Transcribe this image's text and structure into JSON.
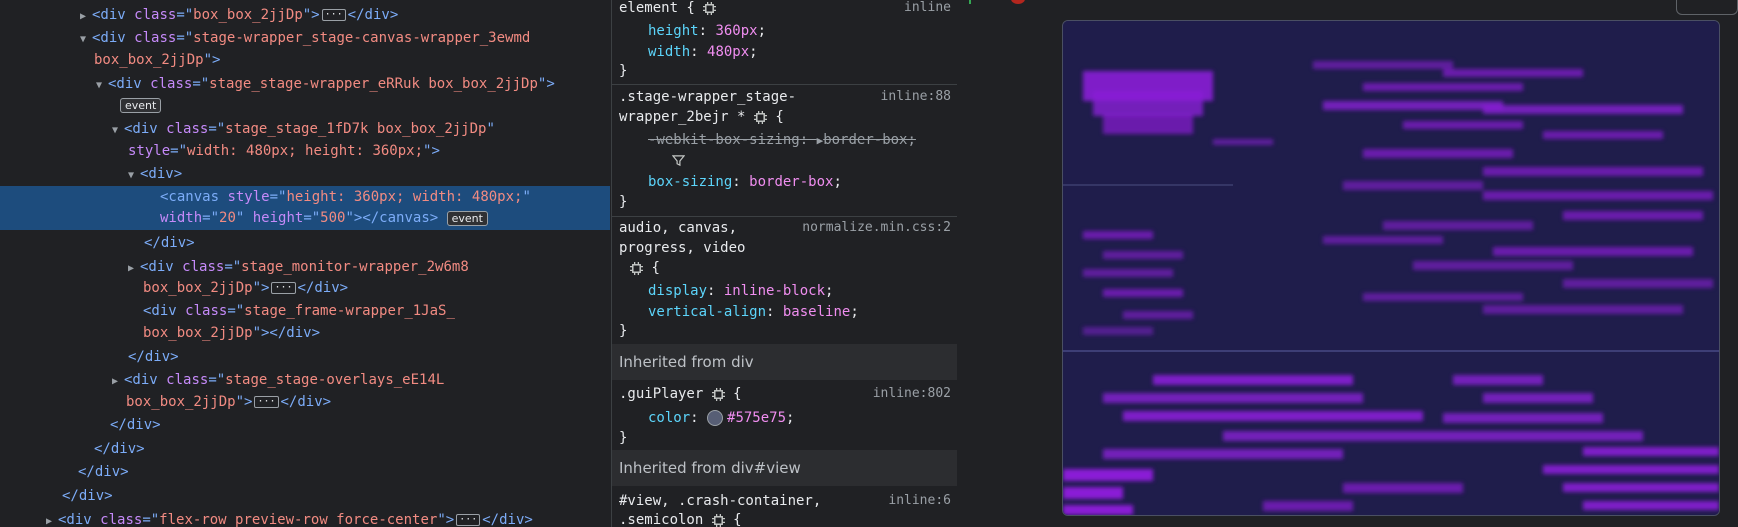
{
  "dom": {
    "line1_cls": "box_box_2jjDp",
    "line2_cls_a": "stage-wrapper_stage-canvas-wrapper_3ewmd",
    "line2_cls_b": "box_box_2jjDp",
    "line3_cls": "stage_stage-wrapper_eRRuk box_box_2jjDp",
    "event_badge": "event",
    "line4_cls": "stage_stage_1fD7k box_box_2jjDp",
    "line4_style": "width: 480px; height: 360px;",
    "canvas_style": "height: 360px; width: 480px;",
    "canvas_width": "20",
    "canvas_height": "500",
    "monitor_cls_a": "stage_monitor-wrapper_2w6m8",
    "monitor_cls_b": "box_box_2jjDp",
    "frame_cls_a": "stage_frame-wrapper_1JaS_",
    "frame_cls_b": "box_box_2jjDp",
    "overlays_cls_a": "stage_stage-overlays_eE14L",
    "overlays_cls_b": "box_box_2jjDp",
    "last_cls": "flex-row preview-row force-center"
  },
  "styles": {
    "element_selector": "element {",
    "element_source": "inline",
    "height_prop": "height",
    "height_val": "360px",
    "width_prop": "width",
    "width_val": "480px",
    "rule2_selector_a": ".stage-wrapper_stage-",
    "rule2_selector_b": "wrapper_2bejr *",
    "rule2_source": "inline:88",
    "webkit_prop": "-webkit-box-sizing",
    "webkit_val": "border-box",
    "box_prop": "box-sizing",
    "box_val": "border-box",
    "rule3_selector_a": "audio, canvas,",
    "rule3_selector_b": "progress, video",
    "rule3_source": "normalize.min.css:2",
    "display_prop": "display",
    "display_val": "inline-block",
    "valign_prop": "vertical-align",
    "valign_val": "baseline",
    "inherited1": "Inherited from div",
    "gui_selector": ".guiPlayer",
    "gui_source": "inline:802",
    "color_prop": "color",
    "color_val": "#575e75",
    "inherited2": "Inherited from div#view",
    "view_selector_a": "#view, .crash-container,",
    "view_selector_b": ".semicolon",
    "view_source": "inline:6",
    "open_brace": "{",
    "close_brace": "}"
  },
  "colors": {
    "stage_bg": "#1f1d4b",
    "stripe": "#8a1fd6",
    "swatch": "#575e75"
  }
}
